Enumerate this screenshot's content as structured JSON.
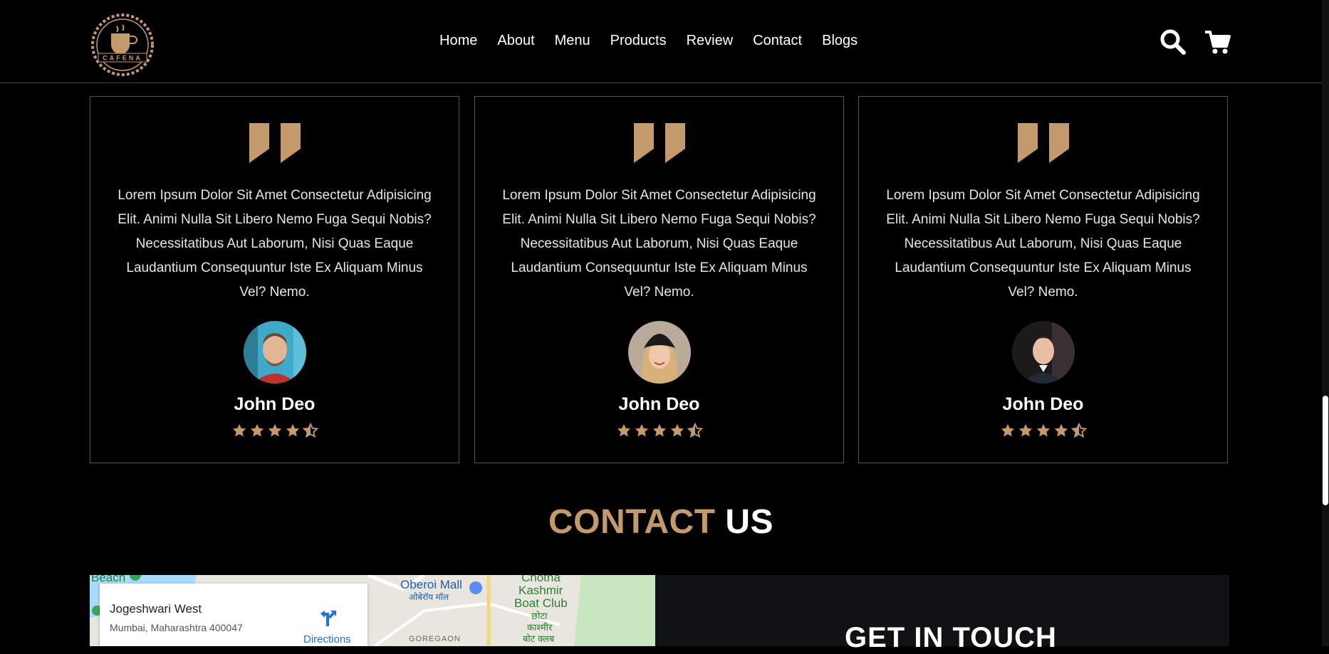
{
  "brand": {
    "logo_text": "CAFENA"
  },
  "nav": {
    "items": [
      "Home",
      "About",
      "Menu",
      "Products",
      "Review",
      "Contact",
      "Blogs"
    ]
  },
  "colors": {
    "accent": "#c49a6c",
    "background": "#000000"
  },
  "reviews": [
    {
      "text": "Lorem Ipsum Dolor Sit Amet Consectetur Adipisicing Elit. Animi Nulla Sit Libero Nemo Fuga Sequi Nobis? Necessitatibus Aut Laborum, Nisi Quas Eaque Laudantium Consequuntur Iste Ex Aliquam Minus Vel? Nemo.",
      "name": "John Deo",
      "rating": 4.5
    },
    {
      "text": "Lorem Ipsum Dolor Sit Amet Consectetur Adipisicing Elit. Animi Nulla Sit Libero Nemo Fuga Sequi Nobis? Necessitatibus Aut Laborum, Nisi Quas Eaque Laudantium Consequuntur Iste Ex Aliquam Minus Vel? Nemo.",
      "name": "John Deo",
      "rating": 4.5
    },
    {
      "text": "Lorem Ipsum Dolor Sit Amet Consectetur Adipisicing Elit. Animi Nulla Sit Libero Nemo Fuga Sequi Nobis? Necessitatibus Aut Laborum, Nisi Quas Eaque Laudantium Consequuntur Iste Ex Aliquam Minus Vel? Nemo.",
      "name": "John Deo",
      "rating": 4.5
    }
  ],
  "contact": {
    "title_accent": "CONTACT",
    "title_rest": "US",
    "map": {
      "place": "Jogeshwari West",
      "address": "Mumbai, Maharashtra 400047",
      "directions": "Directions",
      "labels": [
        "Beach",
        "Oberoi Mall",
        "ओबेरॉय मॉल",
        "Chotha",
        "Kashmir",
        "Boat Club",
        "छोटा",
        "काश्मीर",
        "बोट क्लब",
        "GOREGAON"
      ]
    },
    "panel_title": "GET IN TOUCH"
  }
}
